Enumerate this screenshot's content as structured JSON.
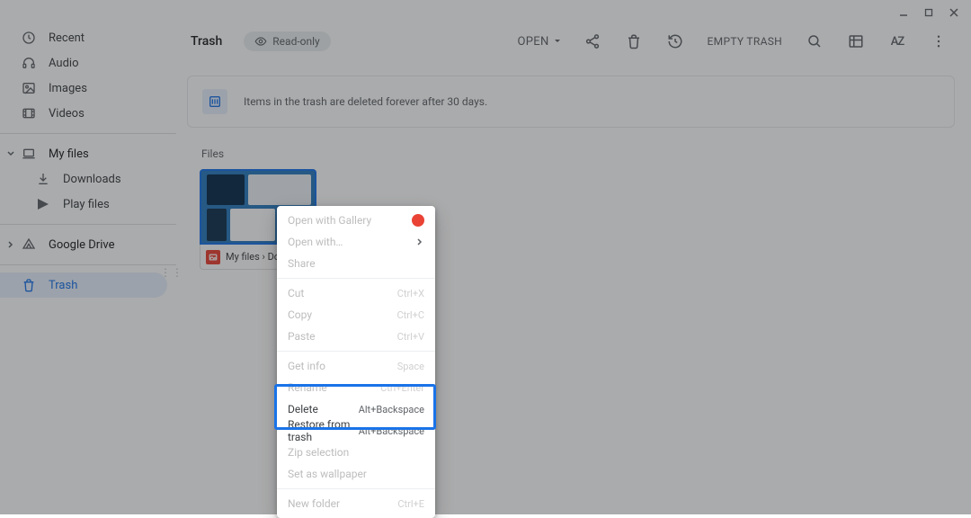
{
  "window": {
    "minimize": "_",
    "maximize": "□",
    "close": "✕"
  },
  "sidebar": {
    "recent": "Recent",
    "audio": "Audio",
    "images": "Images",
    "videos": "Videos",
    "myfiles": "My files",
    "downloads": "Downloads",
    "playfiles": "Play files",
    "gdrive": "Google Drive",
    "trash": "Trash"
  },
  "header": {
    "title": "Trash",
    "readonly": "Read-only",
    "open": "OPEN",
    "empty": "EMPTY TRASH"
  },
  "banner": {
    "text": "Items in the trash are deleted forever after 30 days."
  },
  "files": {
    "section_label": "Files",
    "item_caption": "My files › Do…"
  },
  "ctx": {
    "open_gallery": "Open with Gallery",
    "open_with": "Open with…",
    "share": "Share",
    "cut": "Cut",
    "cut_key": "Ctrl+X",
    "copy": "Copy",
    "copy_key": "Ctrl+C",
    "paste": "Paste",
    "paste_key": "Ctrl+V",
    "getinfo": "Get info",
    "getinfo_key": "Space",
    "rename": "Rename",
    "rename_key": "Ctrl+Enter",
    "delete": "Delete",
    "delete_key": "Alt+Backspace",
    "restore": "Restore from trash",
    "restore_key": "Alt+Backspace",
    "zip": "Zip selection",
    "wallpaper": "Set as wallpaper",
    "newfolder": "New folder",
    "newfolder_key": "Ctrl+E"
  }
}
